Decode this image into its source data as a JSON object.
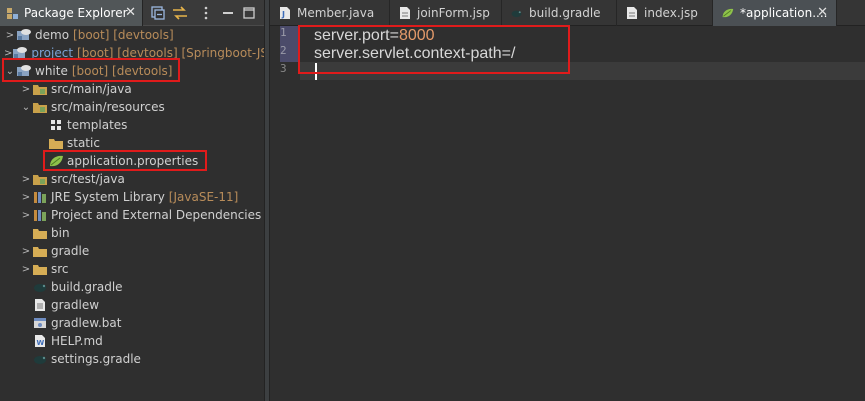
{
  "explorer": {
    "tab_title": "Package Explorer",
    "tab_close": "✕",
    "toolbar_icons": [
      "collapse-all-icon",
      "link-with-editor-icon",
      "view-menu-icon",
      "minimize-icon",
      "maximize-icon"
    ],
    "tree": [
      {
        "label": "demo",
        "dec": "[boot] [devtools]",
        "arrow": ">"
      },
      {
        "label": "project",
        "dec": "[boot] [devtools] [Springboot-JS",
        "arrow": ">",
        "dec_blue": true
      },
      {
        "label": "white",
        "dec": "[boot] [devtools]",
        "arrow": "v"
      },
      {
        "label": "src/main/java",
        "arrow": ">"
      },
      {
        "label": "src/main/resources",
        "arrow": "v"
      },
      {
        "label": "templates"
      },
      {
        "label": "static"
      },
      {
        "label": "application.properties"
      },
      {
        "label": "src/test/java",
        "arrow": ">"
      },
      {
        "label": "JRE System Library",
        "dec": "[JavaSE-11]",
        "arrow": ">"
      },
      {
        "label": "Project and External Dependencies",
        "arrow": ">"
      },
      {
        "label": "bin"
      },
      {
        "label": "gradle",
        "arrow": ">"
      },
      {
        "label": "src",
        "arrow": ">"
      },
      {
        "label": "build.gradle"
      },
      {
        "label": "gradlew"
      },
      {
        "label": "gradlew.bat"
      },
      {
        "label": "HELP.md"
      },
      {
        "label": "settings.gradle"
      }
    ]
  },
  "editor": {
    "tabs": [
      {
        "label": "Member.java"
      },
      {
        "label": "joinForm.jsp"
      },
      {
        "label": "build.gradle"
      },
      {
        "label": "index.jsp"
      },
      {
        "label": "*application....",
        "active": true,
        "close": "✕"
      }
    ],
    "line_numbers": [
      "1",
      "2",
      "3"
    ],
    "lines": [
      {
        "key": "server.port=",
        "value": "8000"
      },
      {
        "key": "server.servlet.context-path=/",
        "value": ""
      },
      {
        "key": "",
        "value": ""
      }
    ]
  },
  "colors": {
    "annotation": "#e01b1b",
    "property_value": "#e49a6a",
    "decoration": "#b88c5a"
  }
}
